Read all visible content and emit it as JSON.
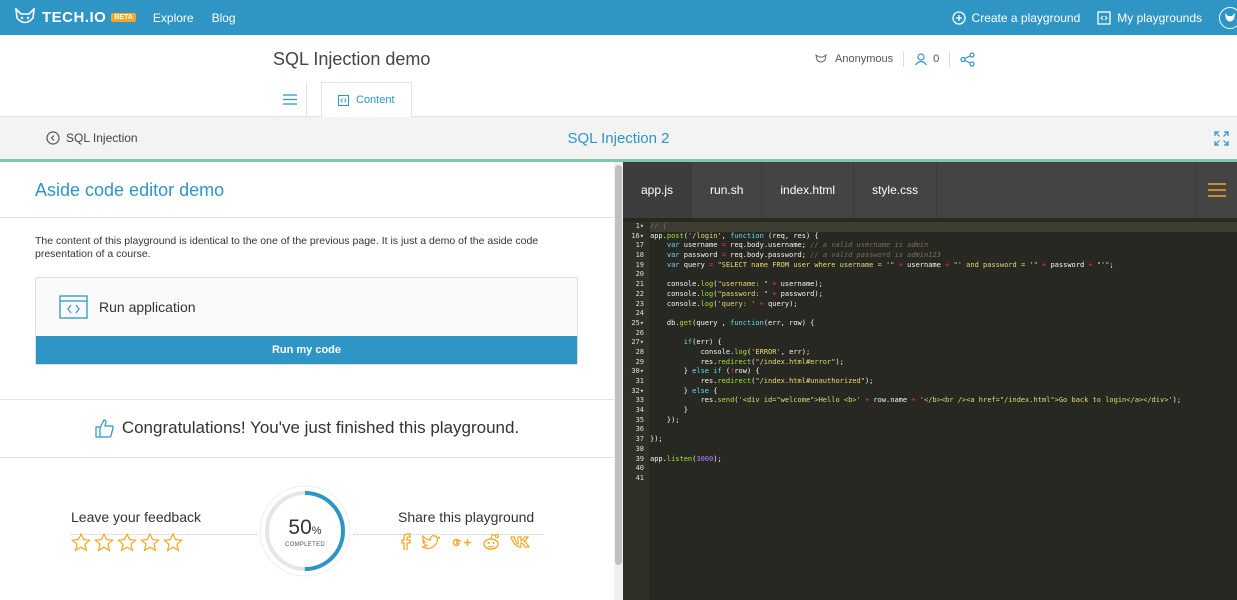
{
  "app": {
    "brand": "TECH.IO",
    "beta": "BETA"
  },
  "topnav": {
    "links": [
      "Explore",
      "Blog"
    ],
    "create": "Create a playground",
    "my": "My playgrounds"
  },
  "header": {
    "title": "SQL Injection demo",
    "author": "Anonymous",
    "followers": "0",
    "tab": "Content"
  },
  "lesson": {
    "back": "SQL Injection",
    "title": "SQL Injection 2"
  },
  "aside": {
    "title": "Aside code editor demo",
    "description": "The content of this playground is identical to the one of the previous page. It is just a demo of the aside code presentation of a course.",
    "run_title": "Run application",
    "run_button": "Run my code",
    "congrats": "Congratulations! You've just finished this playground.",
    "feedback": "Leave your feedback",
    "share": "Share this playground",
    "progress_value": "50",
    "progress_unit": "%",
    "progress_caption": "COMPLETED",
    "progress_fraction": 0.5,
    "rating_stars": 5,
    "share_icons": [
      "facebook-icon",
      "twitter-icon",
      "google-plus-icon",
      "reddit-icon",
      "vk-icon"
    ]
  },
  "editor": {
    "tabs": [
      "app.js",
      "run.sh",
      "index.html",
      "style.css"
    ],
    "active_tab": "app.js",
    "line_numbers": [
      "1",
      "16",
      "17",
      "18",
      "19",
      "20",
      "21",
      "22",
      "23",
      "24",
      "25",
      "26",
      "27",
      "28",
      "29",
      "30",
      "31",
      "32",
      "33",
      "34",
      "35",
      "36",
      "37",
      "38",
      "39",
      "40",
      "41"
    ],
    "fold_lines": [
      "1",
      "16",
      "25",
      "27",
      "30",
      "32"
    ],
    "code": [
      "// {",
      "app.post('/login', function (req, res) {",
      "    var username = req.body.username; // a valid username is admin",
      "    var password = req.body.password; // a valid password is admin123",
      "    var query = \"SELECT name FROM user where username = '\" + username + \"' and password = '\" + password + \"'\";",
      "",
      "    console.log(\"username: \" + username);",
      "    console.log(\"password: \" + password);",
      "    console.log('query: ' + query);",
      "",
      "    db.get(query , function(err, row) {",
      "",
      "        if(err) {",
      "            console.log('ERROR', err);",
      "            res.redirect(\"/index.html#error\");",
      "        } else if (!row) {",
      "            res.redirect(\"/index.html#unauthorized\");",
      "        } else {",
      "            res.send('<div id=\"welcome\">Hello <b>' + row.name + '</b><br /><a href=\"/index.html\">Go back to login</a></div>');",
      "        }",
      "    });",
      "",
      "});",
      "",
      "app.listen(3000);",
      "",
      ""
    ]
  },
  "colors": {
    "accent": "#2f95c5",
    "editor_bg": "#272822",
    "star": "#f5a623",
    "progress_track": "#e6e6e6"
  }
}
